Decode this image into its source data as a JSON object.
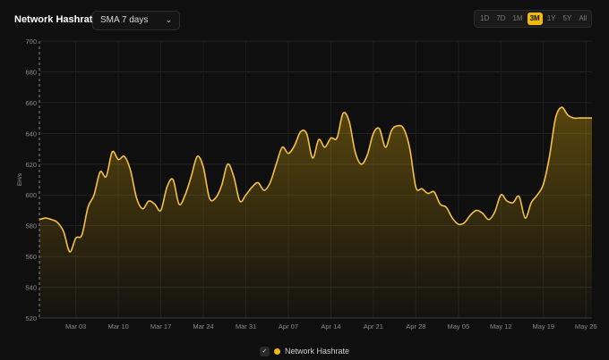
{
  "header": {
    "title": "Network Hashrate",
    "sma_select": {
      "value": "SMA 7 days",
      "chevron": "⌄"
    },
    "ranges": [
      "1D",
      "7D",
      "1M",
      "3M",
      "1Y",
      "5Y",
      "All"
    ],
    "active_range": "3M"
  },
  "legend": {
    "check": "✓",
    "label": "Network Hashrate"
  },
  "colors": {
    "line": "#f5c046",
    "accent": "#f0b90b",
    "background": "#0f0f0f"
  },
  "chart_data": {
    "type": "area",
    "title": "Network Hashrate",
    "ylabel": "EH/s",
    "ylim": [
      520,
      700
    ],
    "yticks": [
      520,
      540,
      560,
      580,
      600,
      620,
      640,
      660,
      680,
      700
    ],
    "x_start": "2024-02-26",
    "xticks": [
      {
        "day": 6,
        "label": "Mar 03"
      },
      {
        "day": 13,
        "label": "Mar 10"
      },
      {
        "day": 20,
        "label": "Mar 17"
      },
      {
        "day": 27,
        "label": "Mar 24"
      },
      {
        "day": 34,
        "label": "Mar 31"
      },
      {
        "day": 41,
        "label": "Apr 07"
      },
      {
        "day": 48,
        "label": "Apr 14"
      },
      {
        "day": 55,
        "label": "Apr 21"
      },
      {
        "day": 62,
        "label": "Apr 28"
      },
      {
        "day": 69,
        "label": "May 05"
      },
      {
        "day": 76,
        "label": "May 12"
      },
      {
        "day": 83,
        "label": "May 19"
      },
      {
        "day": 90,
        "label": "May 26"
      }
    ],
    "series": [
      {
        "name": "Network Hashrate",
        "x": [
          0,
          1,
          2,
          3,
          4,
          5,
          6,
          7,
          8,
          9,
          10,
          11,
          12,
          13,
          14,
          15,
          16,
          17,
          18,
          19,
          20,
          21,
          22,
          23,
          24,
          25,
          26,
          27,
          28,
          29,
          30,
          31,
          32,
          33,
          34,
          35,
          36,
          37,
          38,
          39,
          40,
          41,
          42,
          43,
          44,
          45,
          46,
          47,
          48,
          49,
          50,
          51,
          52,
          53,
          54,
          55,
          56,
          57,
          58,
          59,
          60,
          61,
          62,
          63,
          64,
          65,
          66,
          67,
          68,
          69,
          70,
          71,
          72,
          73,
          74,
          75,
          76,
          77,
          78,
          79,
          80,
          81,
          82,
          83,
          84,
          85,
          86,
          87,
          88,
          89,
          90,
          91
        ],
        "values": [
          584,
          585,
          584,
          582,
          576,
          563,
          572,
          574,
          592,
          600,
          615,
          612,
          628,
          623,
          625,
          616,
          598,
          591,
          596,
          594,
          590,
          605,
          610,
          594,
          600,
          612,
          625,
          618,
          598,
          598,
          606,
          620,
          612,
          596,
          600,
          605,
          608,
          603,
          608,
          620,
          631,
          627,
          632,
          641,
          640,
          624,
          636,
          631,
          637,
          637,
          653,
          648,
          628,
          620,
          626,
          640,
          643,
          631,
          642,
          645,
          643,
          630,
          605,
          604,
          601,
          602,
          594,
          592,
          585,
          581,
          582,
          587,
          590,
          588,
          584,
          589,
          600,
          596,
          595,
          599,
          585,
          595,
          600,
          607,
          625,
          650,
          657,
          652,
          650,
          650,
          650,
          650
        ]
      }
    ]
  }
}
